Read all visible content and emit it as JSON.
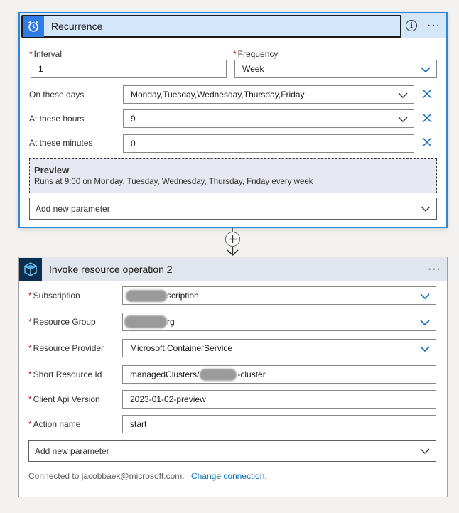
{
  "recurrence": {
    "title": "Recurrence",
    "menu_label": "···",
    "interval": {
      "label": "Interval",
      "value": "1"
    },
    "frequency": {
      "label": "Frequency",
      "value": "Week"
    },
    "on_these_days": {
      "label": "On these days",
      "value": "Monday,Tuesday,Wednesday,Thursday,Friday"
    },
    "at_these_hours": {
      "label": "At these hours",
      "value": "9"
    },
    "at_these_minutes": {
      "label": "At these minutes",
      "value": "0"
    },
    "preview": {
      "title": "Preview",
      "text": "Runs at 9:00 on Monday, Tuesday, Wednesday, Thursday, Friday every week"
    },
    "add_param": "Add new parameter"
  },
  "invoke": {
    "title": "Invoke resource operation 2",
    "menu_label": "···",
    "subscription": {
      "label": "Subscription",
      "value": "scription"
    },
    "resource_group": {
      "label": "Resource Group",
      "value": "rg"
    },
    "resource_provider": {
      "label": "Resource Provider",
      "value": "Microsoft.ContainerService"
    },
    "short_resource_id": {
      "label": "Short Resource Id",
      "value_prefix": "managedClusters/",
      "value_suffix": "-cluster"
    },
    "client_api_version": {
      "label": "Client Api Version",
      "value": "2023-01-02-preview"
    },
    "action_name": {
      "label": "Action name",
      "value": "start"
    },
    "add_param": "Add new parameter",
    "connected_text": "Connected to jacobbaek@microsoft.com.",
    "change_connection": "Change connection."
  },
  "colors": {
    "accent": "#2b88d8",
    "required": "#a4262c",
    "chevron": "#0f6cbd",
    "link": "#0f6cbd"
  },
  "icons": [
    "alarm-clock-icon",
    "info-icon",
    "more-options-icon",
    "chevron-down-icon",
    "clear-icon",
    "plus-icon",
    "arrow-down-icon",
    "cube-icon"
  ]
}
